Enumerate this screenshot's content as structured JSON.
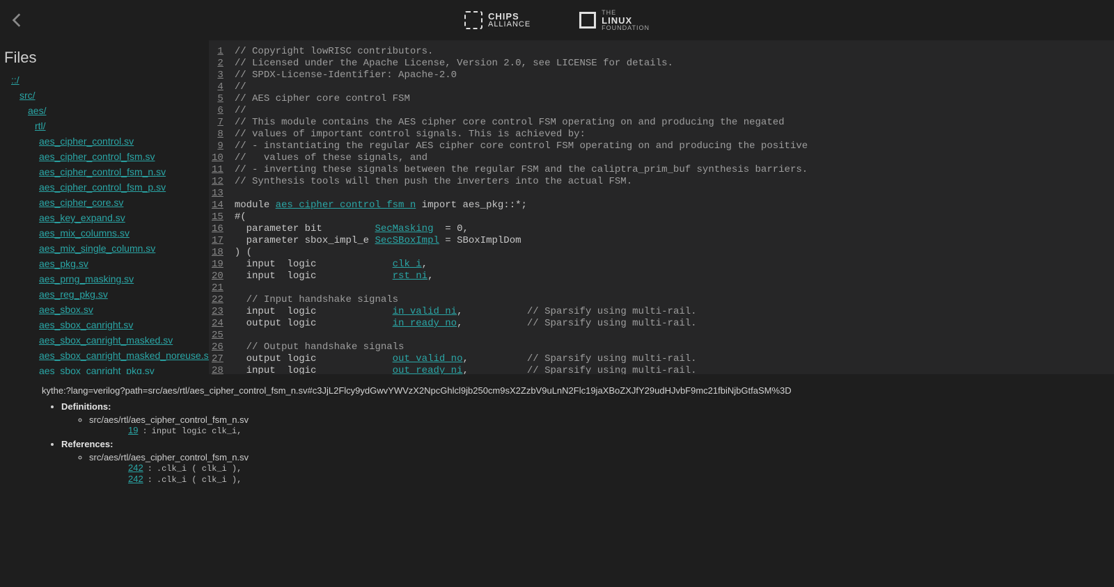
{
  "header": {
    "chips_top": "CHIPS",
    "chips_bottom": "ALLIANCE",
    "linux_top": "THE",
    "linux_mid": "LINUX",
    "linux_bottom": "FOUNDATION"
  },
  "sidebar": {
    "title": "Files",
    "root": "::/",
    "dirs": [
      "src/",
      "aes/",
      "rtl/"
    ],
    "files": [
      "aes_cipher_control.sv",
      "aes_cipher_control_fsm.sv",
      "aes_cipher_control_fsm_n.sv",
      "aes_cipher_control_fsm_p.sv",
      "aes_cipher_core.sv",
      "aes_key_expand.sv",
      "aes_mix_columns.sv",
      "aes_mix_single_column.sv",
      "aes_pkg.sv",
      "aes_prng_masking.sv",
      "aes_reg_pkg.sv",
      "aes_sbox.sv",
      "aes_sbox_canright.sv",
      "aes_sbox_canright_masked.sv",
      "aes_sbox_canright_masked_noreuse.sv",
      "aes_sbox_canright_pkg.sv"
    ]
  },
  "code": {
    "lines": [
      {
        "n": 1,
        "type": "c",
        "text": "// Copyright lowRISC contributors."
      },
      {
        "n": 2,
        "type": "c",
        "text": "// Licensed under the Apache License, Version 2.0, see LICENSE for details."
      },
      {
        "n": 3,
        "type": "c",
        "text": "// SPDX-License-Identifier: Apache-2.0"
      },
      {
        "n": 4,
        "type": "c",
        "text": "//"
      },
      {
        "n": 5,
        "type": "c",
        "text": "// AES cipher core control FSM"
      },
      {
        "n": 6,
        "type": "c",
        "text": "//"
      },
      {
        "n": 7,
        "type": "c",
        "text": "// This module contains the AES cipher core control FSM operating on and producing the negated"
      },
      {
        "n": 8,
        "type": "c",
        "text": "// values of important control signals. This is achieved by:"
      },
      {
        "n": 9,
        "type": "c",
        "text": "// - instantiating the regular AES cipher core control FSM operating on and producing the positive"
      },
      {
        "n": 10,
        "type": "c",
        "text": "//   values of these signals, and"
      },
      {
        "n": 11,
        "type": "c",
        "text": "// - inverting these signals between the regular FSM and the caliptra_prim_buf synthesis barriers."
      },
      {
        "n": 12,
        "type": "c",
        "text": "// Synthesis tools will then push the inverters into the actual FSM."
      },
      {
        "n": 13,
        "type": "b",
        "text": ""
      },
      {
        "n": 14,
        "type": "m",
        "pre": "module ",
        "id": "aes_cipher_control_fsm_n",
        "post": " import aes_pkg::*;"
      },
      {
        "n": 15,
        "type": "p",
        "text": "#("
      },
      {
        "n": 16,
        "type": "m",
        "pre": "  parameter bit         ",
        "id": "SecMasking",
        "post": "  = 0,"
      },
      {
        "n": 17,
        "type": "m",
        "pre": "  parameter sbox_impl_e ",
        "id": "SecSBoxImpl",
        "post": " = SBoxImplDom"
      },
      {
        "n": 18,
        "type": "p",
        "text": ") ("
      },
      {
        "n": 19,
        "type": "m",
        "pre": "  input  logic             ",
        "id": "clk_i",
        "post": ","
      },
      {
        "n": 20,
        "type": "m",
        "pre": "  input  logic             ",
        "id": "rst_ni",
        "post": ","
      },
      {
        "n": 21,
        "type": "b",
        "text": ""
      },
      {
        "n": 22,
        "type": "c",
        "text": "  // Input handshake signals"
      },
      {
        "n": 23,
        "type": "m",
        "pre": "  input  logic             ",
        "id": "in_valid_ni",
        "post": ",           // Sparsify using multi-rail."
      },
      {
        "n": 24,
        "type": "m",
        "pre": "  output logic             ",
        "id": "in_ready_no",
        "post": ",           // Sparsify using multi-rail."
      },
      {
        "n": 25,
        "type": "b",
        "text": ""
      },
      {
        "n": 26,
        "type": "c",
        "text": "  // Output handshake signals"
      },
      {
        "n": 27,
        "type": "m",
        "pre": "  output logic             ",
        "id": "out_valid_no",
        "post": ",          // Sparsify using multi-rail."
      },
      {
        "n": 28,
        "type": "m",
        "pre": "  input  logic             ",
        "id": "out_ready_ni",
        "post": ",          // Sparsify using multi-rail."
      }
    ]
  },
  "bottom": {
    "kythe": "kythe:?lang=verilog?path=src/aes/rtl/aes_cipher_control_fsm_n.sv#c3JjL2Flcy9ydGwvYWVzX2NpcGhlcl9jb250cm9sX2ZzbV9uLnN2Flc19jaXBoZXJfY29udHJvbF9mc21fbiNjbGtfaSM%3D",
    "definitions_label": "Definitions:",
    "references_label": "References:",
    "def_file": "src/aes/rtl/aes_cipher_control_fsm_n.sv",
    "def_line": "19",
    "def_colon": ":",
    "def_code": "input  logic             clk_i,",
    "ref_file": "src/aes/rtl/aes_cipher_control_fsm_n.sv",
    "refs": [
      {
        "line": "242",
        "colon": ":",
        "code": ".clk_i             ( clk_i              ),"
      },
      {
        "line": "242",
        "colon": ":",
        "code": ".clk_i             ( clk_i              ),"
      }
    ]
  }
}
